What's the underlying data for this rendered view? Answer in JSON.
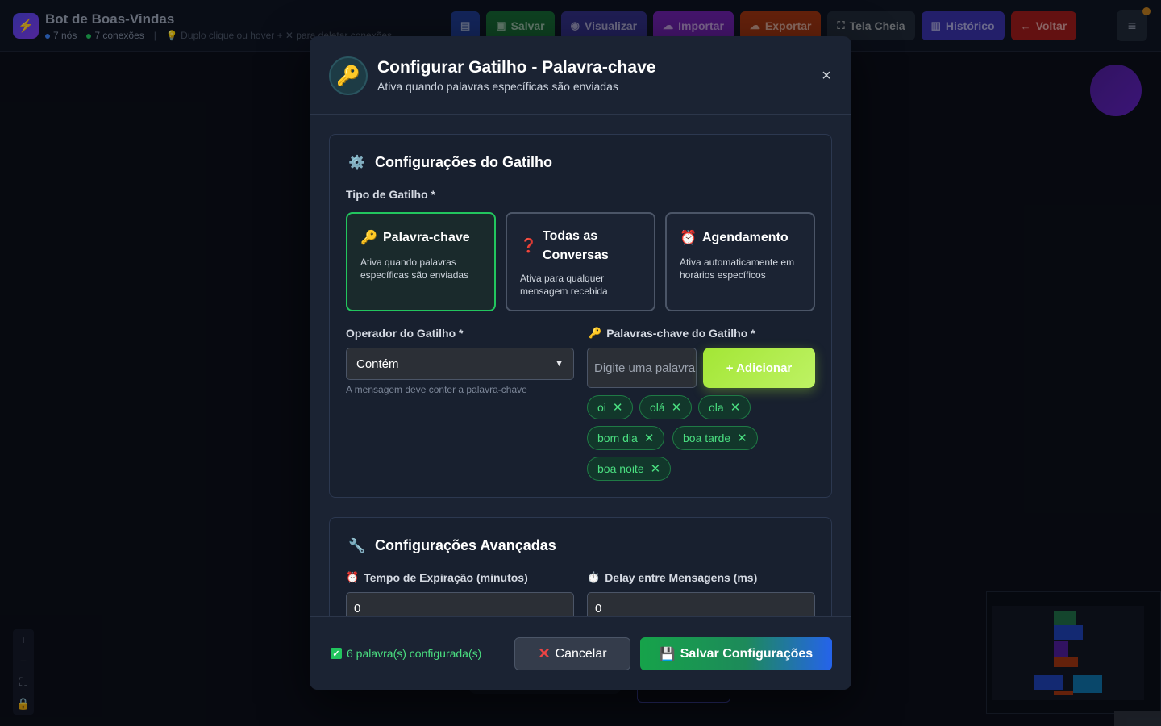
{
  "app": {
    "title": "Bot de Boas-Vindas",
    "nodes": "7 nós",
    "connections": "7 conexões",
    "hint": "Duplo clique ou hover + ✕ para deletar conexões"
  },
  "toolbar": {
    "save": "Salvar",
    "preview": "Visualizar",
    "import": "Importar",
    "export": "Exportar",
    "fullscreen": "Tela Cheia",
    "history": "Histórico",
    "back": "Voltar"
  },
  "modal": {
    "title": "Configurar Gatilho - Palavra-chave",
    "subtitle": "Ativa quando palavras específicas são enviadas",
    "close": "×",
    "trigger_section": {
      "title": "Configurações do Gatilho",
      "type_label": "Tipo de Gatilho *",
      "types": [
        {
          "title": "Palavra-chave",
          "desc": "Ativa quando palavras específicas são enviadas",
          "icon": "key-icon",
          "active": true
        },
        {
          "title": "Todas as Conversas",
          "desc": "Ativa para qualquer mensagem recebida",
          "icon": "diamond-question-icon",
          "active": false
        },
        {
          "title": "Agendamento",
          "desc": "Ativa automaticamente em horários específicos",
          "icon": "alarm-clock-icon",
          "active": false
        }
      ],
      "operator_label": "Operador do Gatilho *",
      "operator_value": "Contém",
      "operator_hint": "A mensagem deve conter a palavra-chave",
      "keywords_label": "Palavras-chave do Gatilho *",
      "keyword_placeholder": "Digite uma palavra",
      "add_button": "+ Adicionar",
      "keywords": [
        "oi",
        "olá",
        "ola",
        "bom dia",
        "boa tarde",
        "boa noite"
      ]
    },
    "advanced_section": {
      "title": "Configurações Avançadas",
      "expiration_label": "Tempo de Expiração (minutos)",
      "expiration_value": "0",
      "delay_label": "Delay entre Mensagens (ms)",
      "delay_value": "0"
    },
    "footer": {
      "status": "6 palavra(s) configurada(s)",
      "cancel": "Cancelar",
      "save": "Salvar Configurações"
    }
  },
  "colors": {
    "accent_green": "#22c55e",
    "chip_text": "#4ade80",
    "add_button": "#a3e635",
    "save_gradient_end": "#2563eb"
  }
}
